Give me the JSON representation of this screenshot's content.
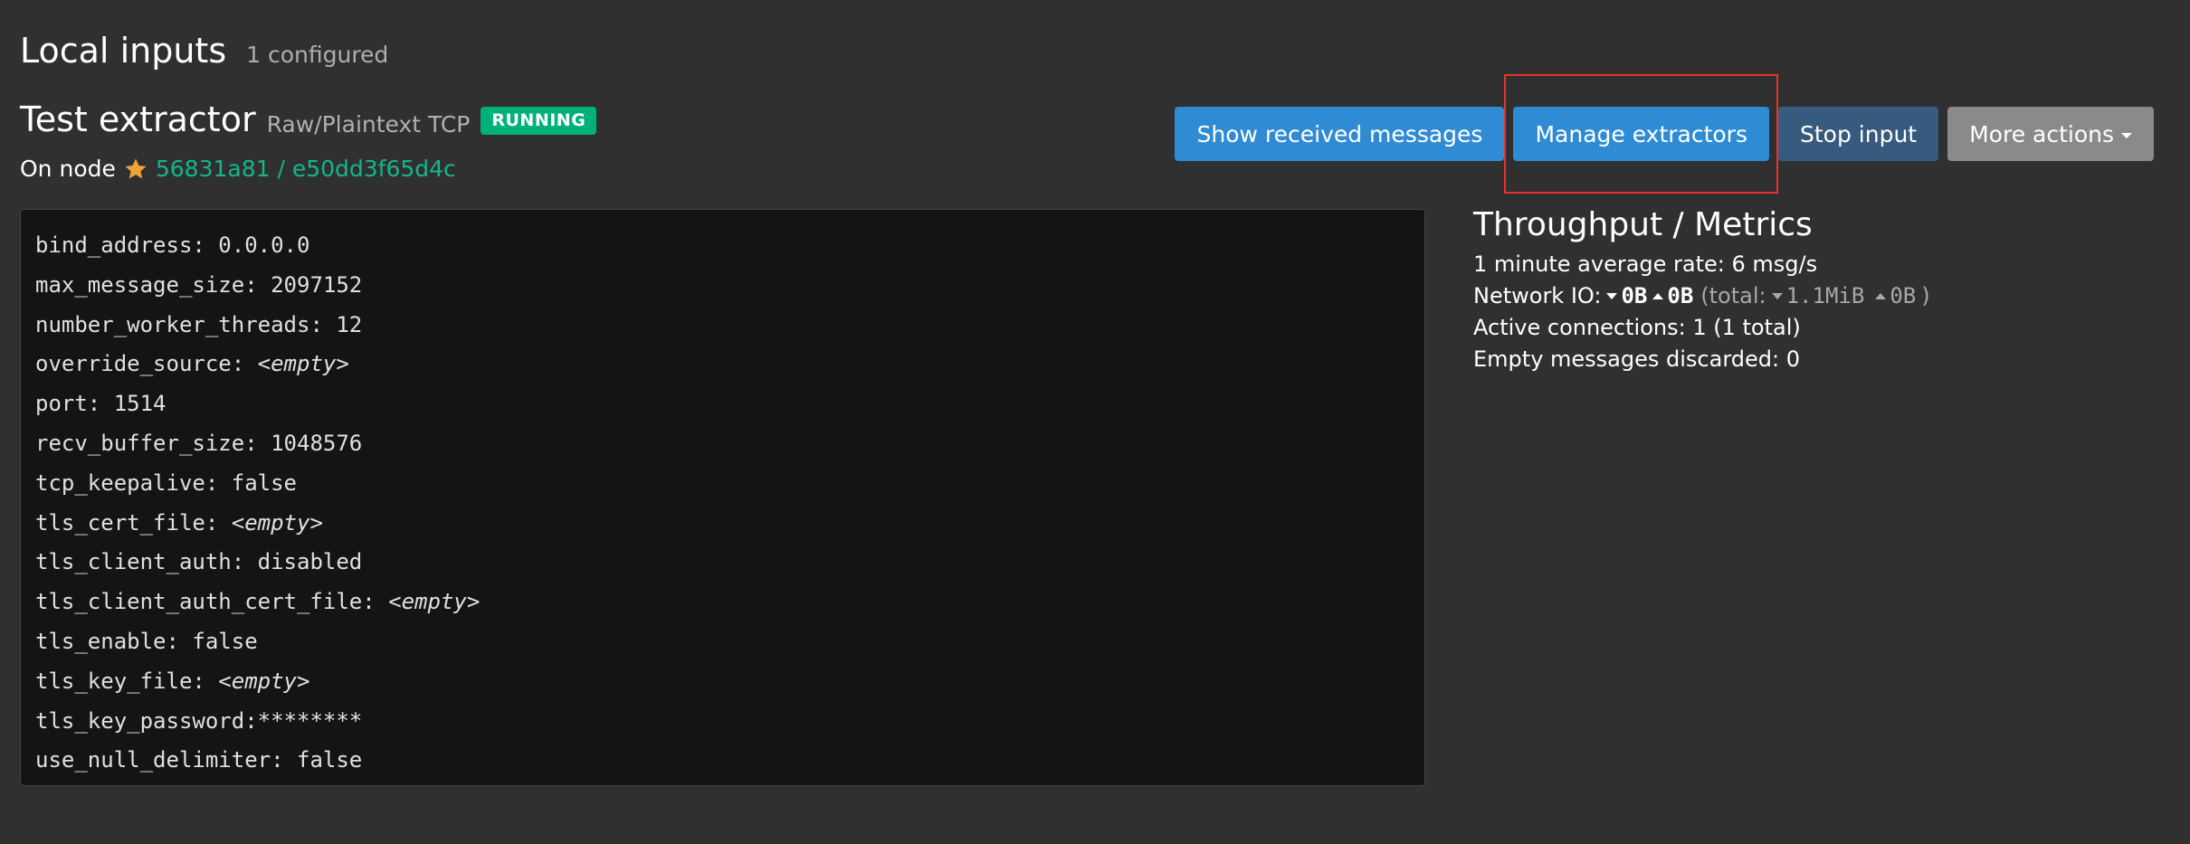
{
  "section": {
    "title": "Local inputs",
    "count": "1 configured"
  },
  "input": {
    "title": "Test extractor",
    "type": "Raw/Plaintext TCP",
    "status": "RUNNING",
    "node_label": "On node",
    "node_link": "56831a81 / e50dd3f65d4c"
  },
  "actions": {
    "show_messages": "Show received messages",
    "manage_extractors": "Manage extractors",
    "stop_input": "Stop input",
    "more_actions": "More actions"
  },
  "config": [
    {
      "key": "bind_address",
      "sep": ": ",
      "value": "0.0.0.0",
      "empty": false
    },
    {
      "key": "max_message_size",
      "sep": ": ",
      "value": "2097152",
      "empty": false
    },
    {
      "key": "number_worker_threads",
      "sep": ": ",
      "value": "12",
      "empty": false
    },
    {
      "key": "override_source",
      "sep": ": ",
      "value": "<empty>",
      "empty": true
    },
    {
      "key": "port",
      "sep": ": ",
      "value": "1514",
      "empty": false
    },
    {
      "key": "recv_buffer_size",
      "sep": ": ",
      "value": "1048576",
      "empty": false
    },
    {
      "key": "tcp_keepalive",
      "sep": ": ",
      "value": "false",
      "empty": false
    },
    {
      "key": "tls_cert_file",
      "sep": ": ",
      "value": "<empty>",
      "empty": true
    },
    {
      "key": "tls_client_auth",
      "sep": ": ",
      "value": "disabled",
      "empty": false
    },
    {
      "key": "tls_client_auth_cert_file",
      "sep": ": ",
      "value": "<empty>",
      "empty": true
    },
    {
      "key": "tls_enable",
      "sep": ": ",
      "value": "false",
      "empty": false
    },
    {
      "key": "tls_key_file",
      "sep": ": ",
      "value": "<empty>",
      "empty": true
    },
    {
      "key": "tls_key_password",
      "sep": ":",
      "value": "********",
      "empty": false
    },
    {
      "key": "use_null_delimiter",
      "sep": ": ",
      "value": "false",
      "empty": false
    }
  ],
  "metrics": {
    "title": "Throughput / Metrics",
    "avg_rate": "1 minute average rate: 6 msg/s",
    "network_label": "Network IO:",
    "net_in": "0B",
    "net_out": "0B",
    "total_open": "(total:",
    "total_in": "1.1MiB",
    "total_out": "0B",
    "total_close": ")",
    "active_connections": "Active connections: 1 (1 total)",
    "empty_discarded": "Empty messages discarded: 0"
  },
  "colors": {
    "background": "#303030",
    "accent_info": "#2f8cd4",
    "accent_primary": "#375a7f",
    "status_running": "#00b27a",
    "link": "#14b68a",
    "highlight": "#e8322d"
  },
  "icons": {
    "node": "star-icon",
    "caret": "caret-down-icon",
    "net_in": "arrow-down-icon",
    "net_out": "arrow-up-icon"
  }
}
